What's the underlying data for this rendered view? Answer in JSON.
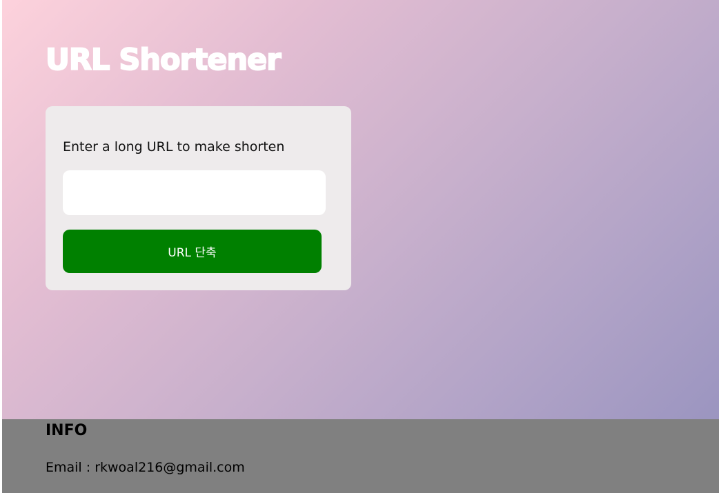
{
  "header": {
    "title": "URL Shortener"
  },
  "form": {
    "label": "Enter a long URL to make shorten",
    "input_value": "",
    "submit_label": "URL 단축"
  },
  "footer": {
    "heading": "INFO",
    "email": "Email : rkwoal216@gmail.com"
  },
  "colors": {
    "button": "#008000",
    "card": "#eeebec",
    "footer": "#808080",
    "gradient_start": "#fdd2dc",
    "gradient_end": "#9b95c0"
  }
}
